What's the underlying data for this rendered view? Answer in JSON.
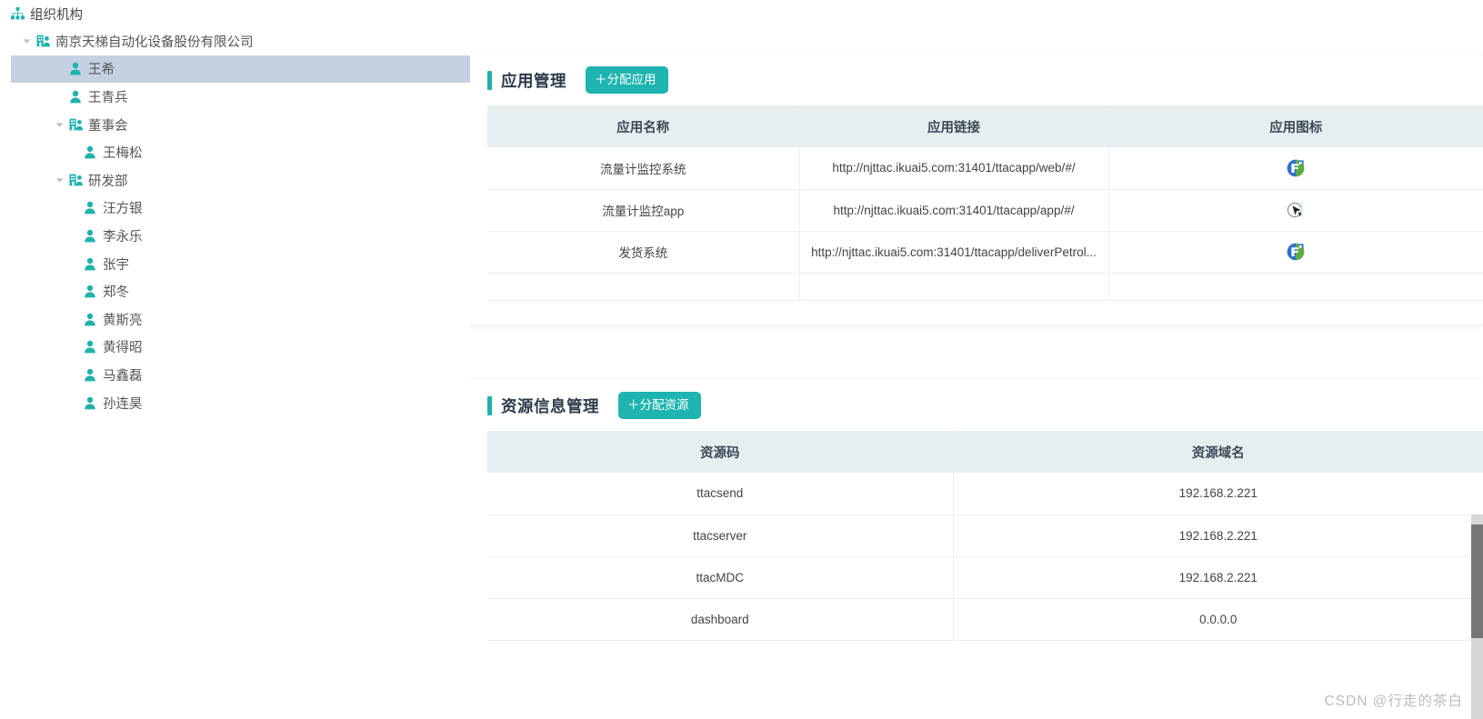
{
  "tree": {
    "root": {
      "label": "组织机构",
      "icon": "sitemap-icon"
    },
    "nodes": [
      {
        "label": "南京天梯自动化设备股份有限公司",
        "level": 1,
        "icon": "org-icon",
        "caret": "down",
        "selected": false
      },
      {
        "label": "王希",
        "level": 2,
        "icon": "person-icon",
        "caret": "none",
        "selected": true
      },
      {
        "label": "王青兵",
        "level": 2,
        "icon": "person-icon",
        "caret": "none",
        "selected": false
      },
      {
        "label": "董事会",
        "level": 2,
        "icon": "org-icon",
        "caret": "down",
        "selected": false
      },
      {
        "label": "王梅松",
        "level": 3,
        "icon": "person-icon",
        "caret": "none",
        "selected": false
      },
      {
        "label": "研发部",
        "level": 2,
        "icon": "org-icon",
        "caret": "down",
        "selected": false
      },
      {
        "label": "汪方银",
        "level": 3,
        "icon": "person-icon",
        "caret": "none",
        "selected": false
      },
      {
        "label": "李永乐",
        "level": 3,
        "icon": "person-icon",
        "caret": "none",
        "selected": false
      },
      {
        "label": "张宇",
        "level": 3,
        "icon": "person-icon",
        "caret": "none",
        "selected": false
      },
      {
        "label": "郑冬",
        "level": 3,
        "icon": "person-icon",
        "caret": "none",
        "selected": false
      },
      {
        "label": "黄斯亮",
        "level": 3,
        "icon": "person-icon",
        "caret": "none",
        "selected": false
      },
      {
        "label": "黄得昭",
        "level": 3,
        "icon": "person-icon",
        "caret": "none",
        "selected": false
      },
      {
        "label": "马鑫磊",
        "level": 3,
        "icon": "person-icon",
        "caret": "none",
        "selected": false
      },
      {
        "label": "孙连昊",
        "level": 3,
        "icon": "person-icon",
        "caret": "none",
        "selected": false
      }
    ]
  },
  "app_panel": {
    "title": "应用管理",
    "button_label": "＋分配应用",
    "columns": [
      "应用名称",
      "应用链接",
      "应用图标"
    ],
    "rows": [
      {
        "name": "流量计监控系统",
        "link": "http://njttac.ikuai5.com:31401/ttacapp/web/#/",
        "icon": "app-logo-blue-green"
      },
      {
        "name": "流量计监控app",
        "link": "http://njttac.ikuai5.com:31401/ttacapp/app/#/",
        "icon": "app-logo-dark-cursor"
      },
      {
        "name": "发货系统",
        "link": "http://njttac.ikuai5.com:31401/ttacapp/deliverPetrol...",
        "icon": "app-logo-blue-green"
      }
    ]
  },
  "resource_panel": {
    "title": "资源信息管理",
    "button_label": "＋分配资源",
    "columns": [
      "资源码",
      "资源域名"
    ],
    "rows": [
      {
        "code": "ttacsend",
        "domain": "192.168.2.221"
      },
      {
        "code": "ttacserver",
        "domain": "192.168.2.221"
      },
      {
        "code": "ttacMDC",
        "domain": "192.168.2.221"
      },
      {
        "code": "dashboard",
        "domain": "0.0.0.0"
      }
    ]
  },
  "watermark": "CSDN @行走的茶白",
  "colors": {
    "accent_teal": "#20b2ac",
    "button_teal": "#1fb4b0",
    "selection_blue": "#c4d1e2",
    "table_header": "#e6eef0"
  }
}
